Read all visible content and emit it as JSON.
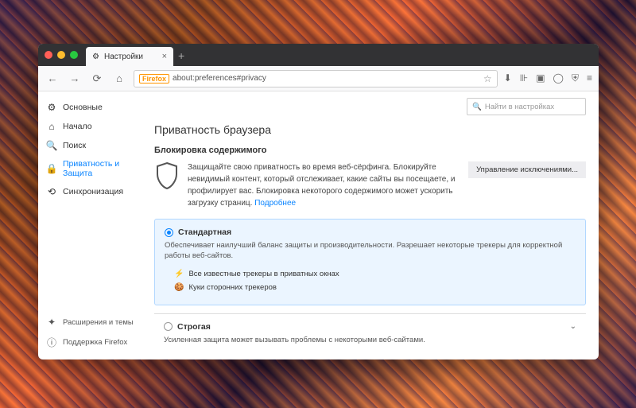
{
  "tab": {
    "title": "Настройки"
  },
  "url": {
    "badge": "Firefox",
    "value": "about:preferences#privacy"
  },
  "search": {
    "placeholder": "Найти в настройках"
  },
  "sidebar": {
    "items": [
      {
        "label": "Основные"
      },
      {
        "label": "Начало"
      },
      {
        "label": "Поиск"
      },
      {
        "label": "Приватность и Защита"
      },
      {
        "label": "Синхронизация"
      }
    ],
    "bottom": [
      {
        "label": "Расширения и темы"
      },
      {
        "label": "Поддержка Firefox"
      }
    ]
  },
  "page": {
    "title": "Приватность браузера",
    "section_title": "Блокировка содержимого",
    "desc": "Защищайте свою приватность во время веб-сёрфинга. Блокируйте невидимый контент, который отслеживает, какие сайты вы посещаете, и профилирует вас. Блокировка некоторого содержимого может ускорить загрузку страниц.",
    "learn_more": "Подробнее",
    "exceptions_btn": "Управление исключениями...",
    "standard": {
      "title": "Стандартная",
      "desc": "Обеспечивает наилучший баланс защиты и производительности. Разрешает некоторые трекеры для корректной работы веб-сайтов.",
      "feat1": "Все известные трекеры в приватных окнах",
      "feat2": "Куки сторонних трекеров"
    },
    "strict": {
      "title": "Строгая",
      "desc": "Усиленная защита может вызывать проблемы с некоторыми веб-сайтами."
    }
  }
}
